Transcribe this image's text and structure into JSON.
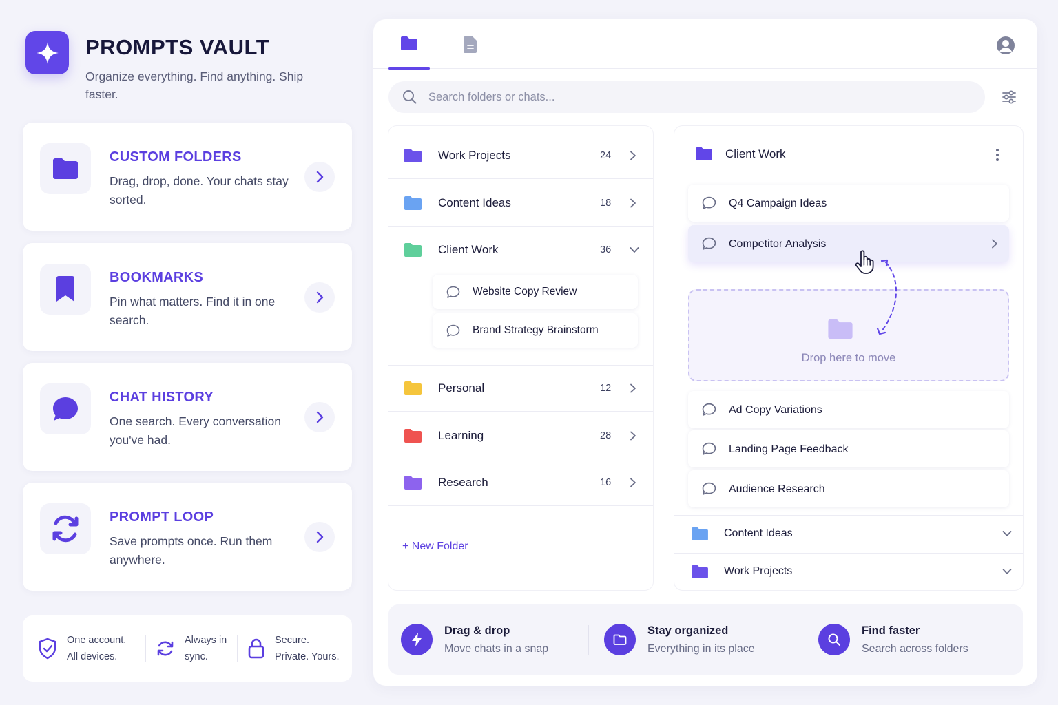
{
  "brand": {
    "title": "PROMPTS VAULT",
    "tagline": "Organize everything. Find anything. Ship faster.",
    "accent": "#6146e8"
  },
  "features": [
    {
      "title": "CUSTOM FOLDERS",
      "desc": "Drag, drop, done. Your chats stay sorted.",
      "icon": "folder-icon"
    },
    {
      "title": "BOOKMARKS",
      "desc": "Pin what matters. Find it in one search.",
      "icon": "bookmark-icon"
    },
    {
      "title": "CHAT HISTORY",
      "desc": "One search. Every conversation you've had.",
      "icon": "chat-bubble-icon"
    },
    {
      "title": "PROMPT LOOP",
      "desc": "Save prompts once. Run them anywhere.",
      "icon": "sync-loop-icon"
    }
  ],
  "trust": [
    {
      "text": "One account. All devices.",
      "icon": "shield-check-icon"
    },
    {
      "text": "Always in sync.",
      "icon": "sync-icon"
    },
    {
      "text": "Secure. Private. Yours.",
      "icon": "lock-icon"
    }
  ],
  "app": {
    "tabs": [
      {
        "name": "folders",
        "icon": "folder-icon",
        "active": true
      },
      {
        "name": "documents",
        "icon": "document-icon",
        "active": false
      }
    ],
    "search_placeholder": "Search folders or chats...",
    "folders": [
      {
        "name": "Work Projects",
        "count": "24",
        "color": "#6b52ea"
      },
      {
        "name": "Content Ideas",
        "count": "18",
        "color": "#6aa3f2"
      },
      {
        "name": "Client Work",
        "count": "36",
        "color": "#5fcf9b",
        "expanded": true
      },
      {
        "name": "Personal",
        "count": "12",
        "color": "#f5c53c"
      },
      {
        "name": "Learning",
        "count": "28",
        "color": "#ef5350"
      },
      {
        "name": "Research",
        "count": "16",
        "color": "#8d63ee"
      }
    ],
    "client_work_chats": [
      "Website Copy Review",
      "Brand Strategy Brainstorm"
    ],
    "new_folder_label": "+ New Folder",
    "detail": {
      "title": "Client Work",
      "chats": [
        "Q4 Campaign Ideas",
        "Competitor Analysis",
        "Ad Copy Variations",
        "Landing Page Feedback",
        "Audience Research"
      ],
      "drop_label": "Drop here to move",
      "collapsed_folders": [
        {
          "name": "Content Ideas",
          "color": "#6aa3f2"
        },
        {
          "name": "Work Projects",
          "color": "#6b52ea"
        }
      ]
    },
    "benefits": [
      {
        "title": "Drag & drop",
        "sub": "Move chats in a snap",
        "icon": "lightning-icon"
      },
      {
        "title": "Stay organized",
        "sub": "Everything in its place",
        "icon": "folder-icon"
      },
      {
        "title": "Find faster",
        "sub": "Search across folders",
        "icon": "search-icon"
      }
    ]
  }
}
